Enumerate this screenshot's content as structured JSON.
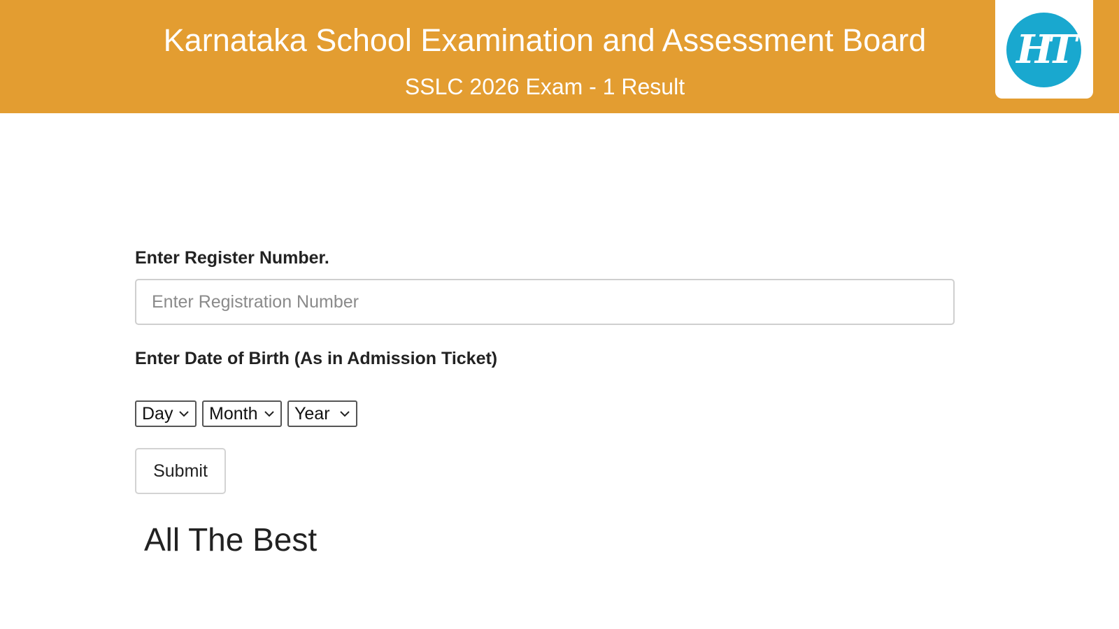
{
  "header": {
    "title": "Karnataka School Examination and Assessment Board",
    "subtitle": "SSLC 2026 Exam - 1 Result",
    "logo_text": "HT",
    "logo_icon": "ht-logo-icon",
    "background_color": "#e39d31",
    "logo_color": "#19a8cf"
  },
  "form": {
    "register_label": "Enter Register Number.",
    "register_placeholder": "Enter Registration Number",
    "register_value": "",
    "dob_label": "Enter Date of Birth (As in Admission Ticket)",
    "day_select": {
      "selected": "Day"
    },
    "month_select": {
      "selected": "Month"
    },
    "year_select": {
      "selected": "Year"
    },
    "submit_label": "Submit"
  },
  "footer_message": "All The Best"
}
